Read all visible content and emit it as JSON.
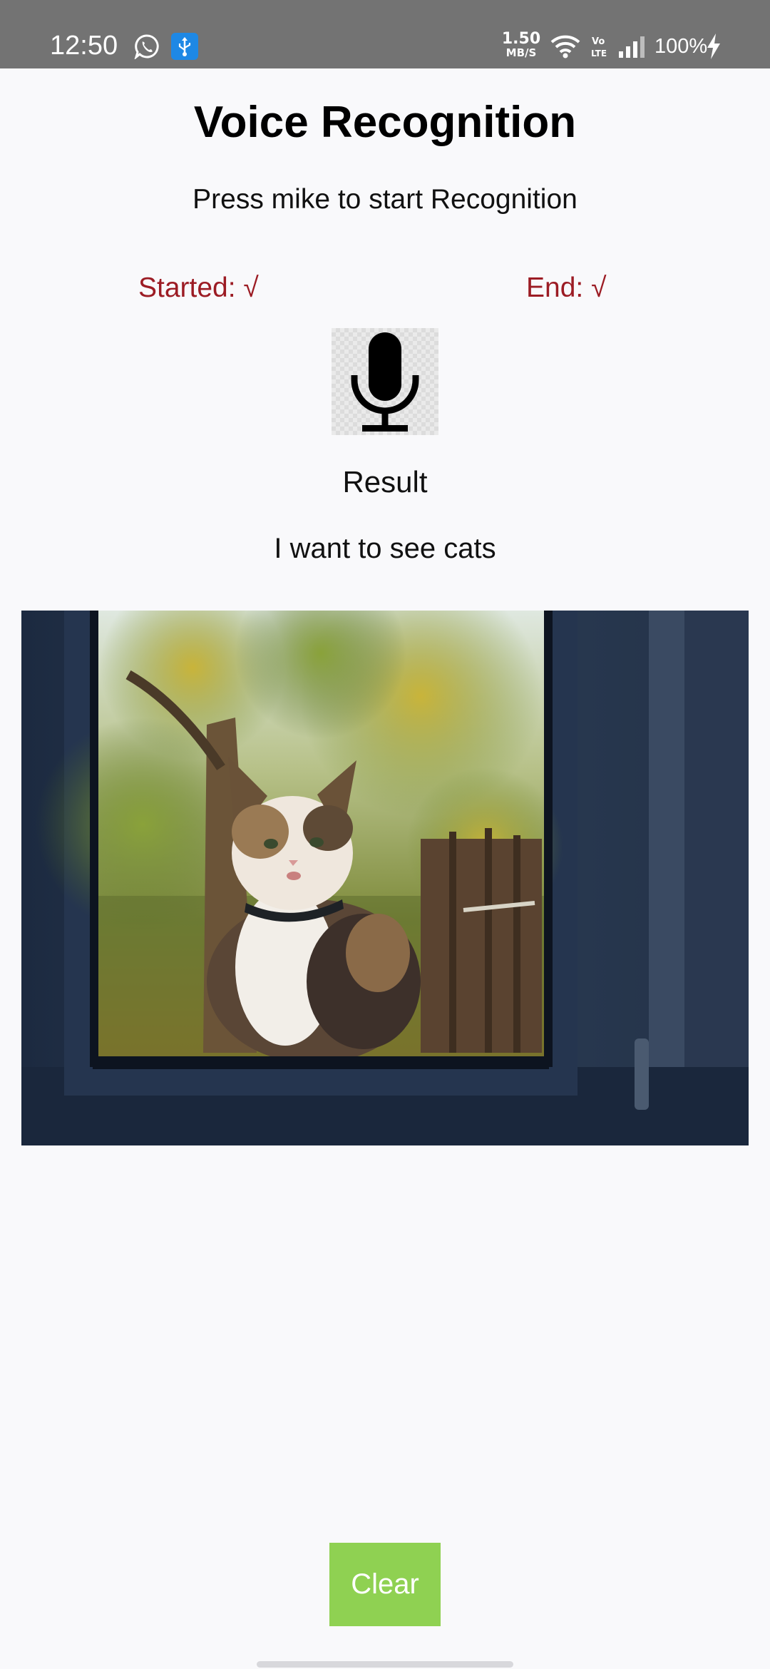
{
  "status_bar": {
    "time": "12:50",
    "net_speed_value": "1.50",
    "net_speed_unit": "MB/S",
    "battery": "100%",
    "icons": [
      "whatsapp-icon",
      "usb-icon",
      "wifi-icon",
      "volte-icon",
      "signal-icon",
      "charging-icon"
    ]
  },
  "app": {
    "title": "Voice Recognition",
    "subtitle": "Press mike to start Recognition",
    "started_label": "Started: √",
    "end_label": "End: √",
    "mic_icon": "microphone-icon",
    "result_label": "Result",
    "result_text": "I want to see cats",
    "clear_label": "Clear"
  },
  "colors": {
    "status_bar": "#737373",
    "background": "#f9f9fb",
    "status_text": "#9c1c24",
    "clear_button": "#8fd152"
  }
}
